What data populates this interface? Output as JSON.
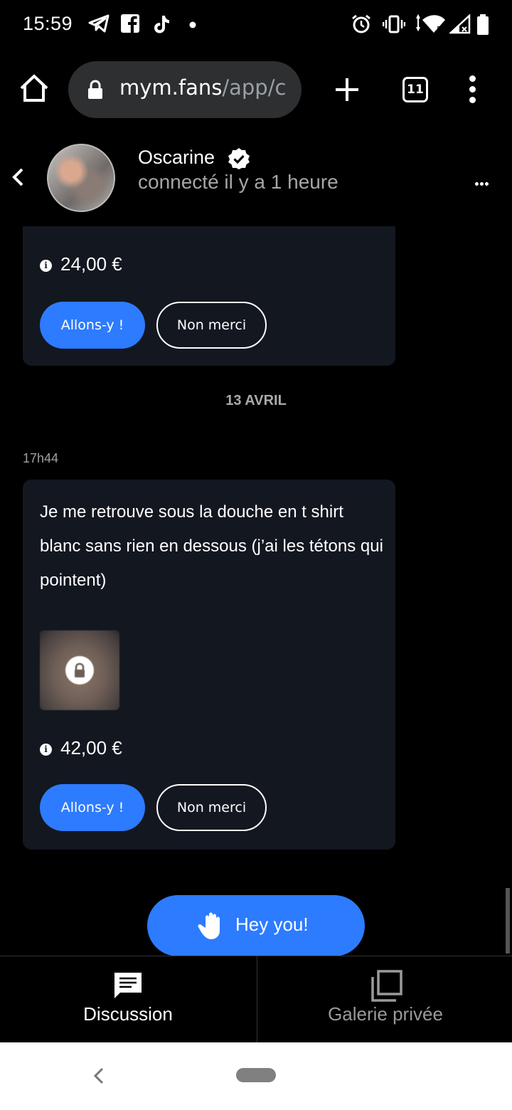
{
  "status_bar": {
    "time": "15:59",
    "icons": [
      "telegram-icon",
      "facebook-icon",
      "tiktok-icon",
      "dot-icon",
      "alarm-icon",
      "vibrate-icon",
      "wifi-icon",
      "signal-icon",
      "battery-icon"
    ]
  },
  "browser": {
    "url_host": "mym.fans",
    "url_path": "/app/c",
    "tab_count": "11"
  },
  "chat_header": {
    "name": "Oscarine",
    "status": "connecté il y a 1 heure"
  },
  "messages": [
    {
      "price": "24,00 €",
      "accept_label": "Allons-y !",
      "decline_label": "Non merci"
    },
    {
      "date_separator": "13 AVRIL",
      "time": "17h44",
      "text": "Je me retrouve sous la douche en t shirt blanc sans rien en dessous (j’ai les tétons qui pointent)",
      "price": "42,00 €",
      "accept_label": "Allons-y !",
      "decline_label": "Non merci"
    }
  ],
  "cta": {
    "label": "Hey you!"
  },
  "bottom_tabs": [
    {
      "label": "Discussion",
      "active": true
    },
    {
      "label": "Galerie privée",
      "active": false
    }
  ],
  "colors": {
    "accent": "#2d7bff",
    "card": "#131720",
    "background": "#000000",
    "muted_text": "#a6a6a6"
  }
}
